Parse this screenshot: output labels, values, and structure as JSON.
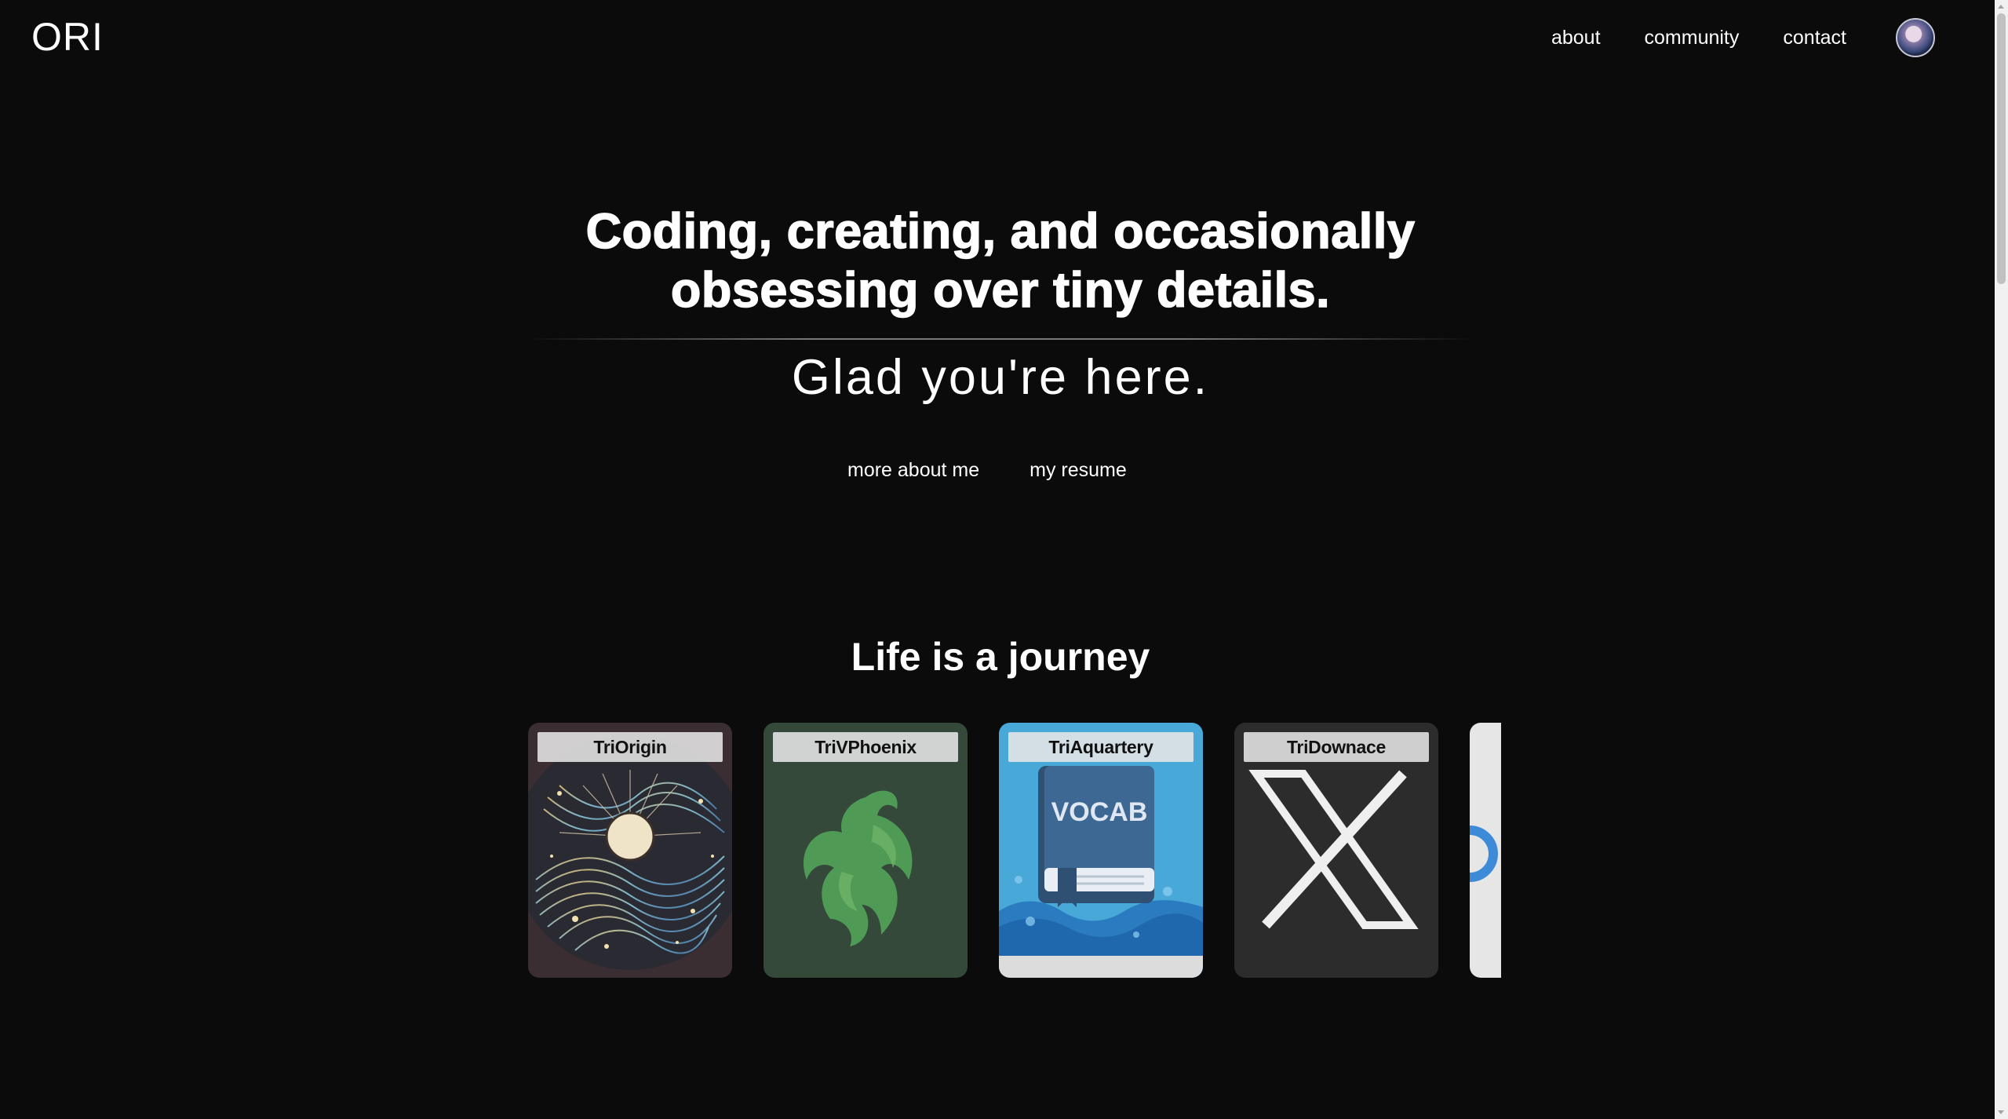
{
  "header": {
    "logo": "ORI",
    "nav": [
      "about",
      "community",
      "contact"
    ],
    "avatar_icon": "user-avatar-icon"
  },
  "hero": {
    "title_line1": "Coding, creating, and occasionally",
    "title_line2": "obsessing over tiny details.",
    "subtitle": "Glad you're here.",
    "links": [
      "more about me",
      "my resume"
    ]
  },
  "journey": {
    "title": "Life is a journey",
    "cards": [
      {
        "label": "TriOrigin",
        "icon": "sun-swirl-art-icon",
        "bg": "#3a2e33"
      },
      {
        "label": "TriVPhoenix",
        "icon": "green-phoenix-icon",
        "bg": "#34493a"
      },
      {
        "label": "TriAquartery",
        "icon": "vocab-book-icon",
        "bg": "#48a9d8"
      },
      {
        "label": "TriDownace",
        "icon": "x-logo-icon",
        "bg": "#2d2c2d"
      },
      {
        "label": "",
        "icon": "blue-ring-icon",
        "bg": "#e6e6e6"
      }
    ],
    "book_text": "VOCAB"
  },
  "colors": {
    "background": "#0b0b0b",
    "text": "#ffffff"
  }
}
